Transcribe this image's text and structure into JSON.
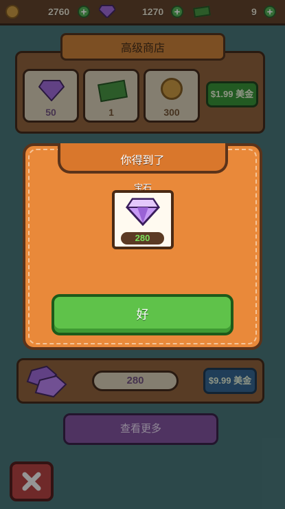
{
  "topbar": {
    "coins": "2760",
    "gems": "1270",
    "cash": "9",
    "plus": "+"
  },
  "shop": {
    "title": "高级商店",
    "row1": {
      "items": [
        {
          "value": "50",
          "icon": "gem-icon"
        },
        {
          "value": "1",
          "icon": "cash-icon"
        },
        {
          "value": "300",
          "icon": "coin-icon"
        }
      ],
      "price": "$1.99 美金"
    },
    "row_bottom": {
      "value": "280",
      "price": "$9.99 美金"
    },
    "see_more": "查看更多"
  },
  "modal": {
    "title": "你得到了",
    "item_label": "宝石",
    "item_quantity": "280",
    "ok_label": "好"
  },
  "colors": {
    "modal_orange": "#e9893a",
    "ok_green": "#5fc24a",
    "gem_purple": "#b57cf0",
    "close_red": "#b23a3a"
  }
}
